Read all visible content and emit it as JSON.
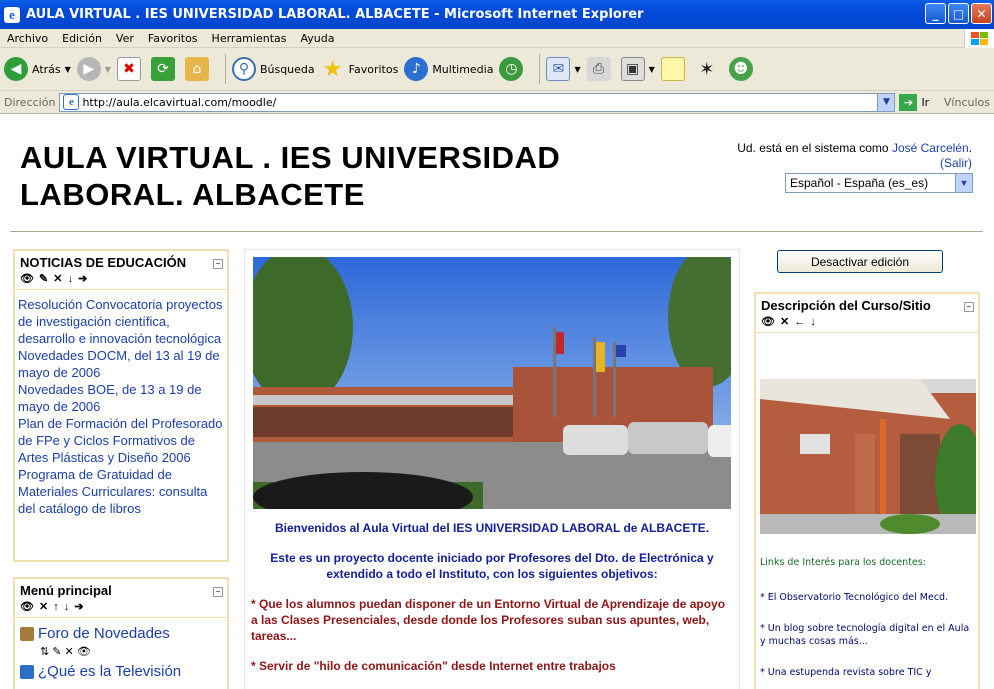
{
  "window": {
    "title": "AULA VIRTUAL . IES UNIVERSIDAD LABORAL. ALBACETE - Microsoft Internet Explorer",
    "min": "_",
    "max": "□",
    "close": "✕"
  },
  "menubar": {
    "items": [
      "Archivo",
      "Edición",
      "Ver",
      "Favoritos",
      "Herramientas",
      "Ayuda"
    ]
  },
  "toolbar": {
    "back": "Atrás",
    "search": "Búsqueda",
    "favorites": "Favoritos",
    "media": "Multimedia"
  },
  "address": {
    "label": "Dirección",
    "url": "http://aula.elcavirtual.com/moodle/",
    "go": "Ir",
    "links": "Vínculos"
  },
  "site": {
    "title": "AULA VIRTUAL . IES UNIVERSIDAD LABORAL. ALBACETE"
  },
  "login": {
    "prefix": "Ud. está en el sistema como ",
    "user": "José Carcelén",
    "suffix": ".",
    "logout": "(Salir)"
  },
  "language": {
    "selected": "Español - España (es_es)"
  },
  "news": {
    "title": "NOTICIAS DE EDUCACIÓN",
    "icons": "👁 ✎ ✕ ↓ ➔",
    "items": [
      "Resolución Convocatoria proyectos de investigación científica, desarrollo e innovación tecnológica",
      "Novedades DOCM, del 13 al 19 de mayo de 2006",
      "Novedades BOE, de 13 a 19 de mayo de 2006",
      "Plan de Formación del Profesorado de FPe y Ciclos Formativos de Artes Plásticas y Diseño 2006",
      "Programa de Gratuidad de Materiales Curriculares: consulta del catálogo de libros"
    ]
  },
  "menu": {
    "title": "Menú principal",
    "icons": "👁 ✕ ↑ ↓ ➔",
    "items": [
      "Foro de Novedades",
      "¿Qué es la Televisión"
    ],
    "item_icons": "⇅ ✎ ✕ 👁"
  },
  "center": {
    "welcome": "Bienvenidos al Aula Virtual del IES UNIVERSIDAD LABORAL de ALBACETE.",
    "intro": "Este es  un proyecto docente iniciado por Profesores del Dto. de Electrónica y extendido a todo el Instituto, con los siguientes objetivos:",
    "obj1": "* Que los alumnos puedan disponer de un Entorno Virtual de Aprendizaje de apoyo a las Clases Presenciales, desde donde los Profesores suban sus apuntes, web, tareas...",
    "obj2": "* Servir de \"hilo de comunicación\" desde Internet entre trabajos"
  },
  "edit_button": "Desactivar edición",
  "description": {
    "title": "Descripción del Curso/Sitio",
    "icons": "👁 ✕ ← ↓",
    "links_title": "Links de Interés para los docentes:",
    "links": [
      "* El Observatorio Tecnológico del Mecd.",
      "* Un blog sobre tecnología digital en el Aula y muchas cosas más...",
      "* Una estupenda revista sobre TIC y"
    ]
  }
}
